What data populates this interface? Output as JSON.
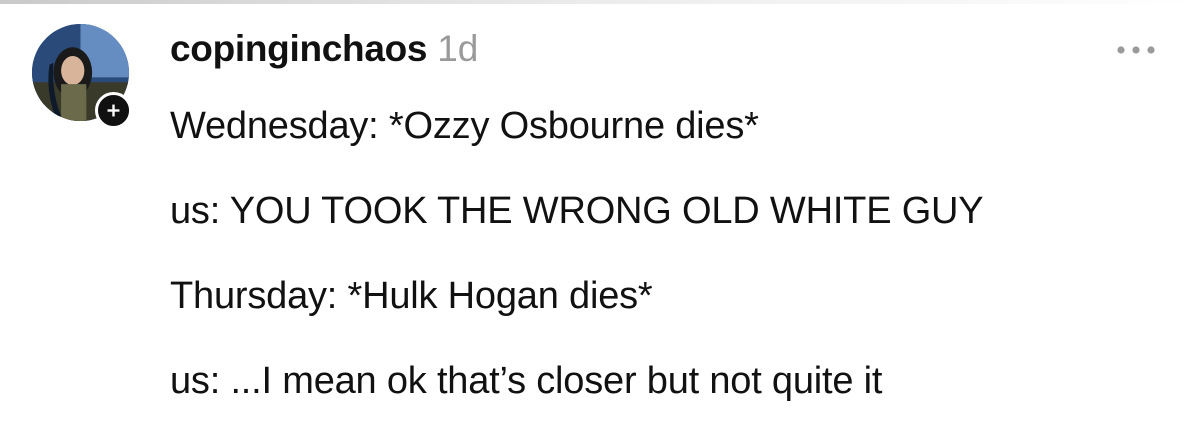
{
  "post": {
    "username": "copinginchaos",
    "timestamp": "1d",
    "lines": [
      "Wednesday: *Ozzy Osbourne dies*",
      "us: YOU TOOK THE WRONG OLD WHITE GUY",
      "Thursday: *Hulk Hogan dies*",
      "us: ...I mean ok that’s closer but not quite it"
    ]
  },
  "icons": {
    "avatar": "profile-photo",
    "follow": "plus-icon",
    "more": "more-horizontal-icon"
  },
  "colors": {
    "text": "#111111",
    "muted": "#9a9a9a",
    "badge": "#111111",
    "background": "#ffffff"
  }
}
